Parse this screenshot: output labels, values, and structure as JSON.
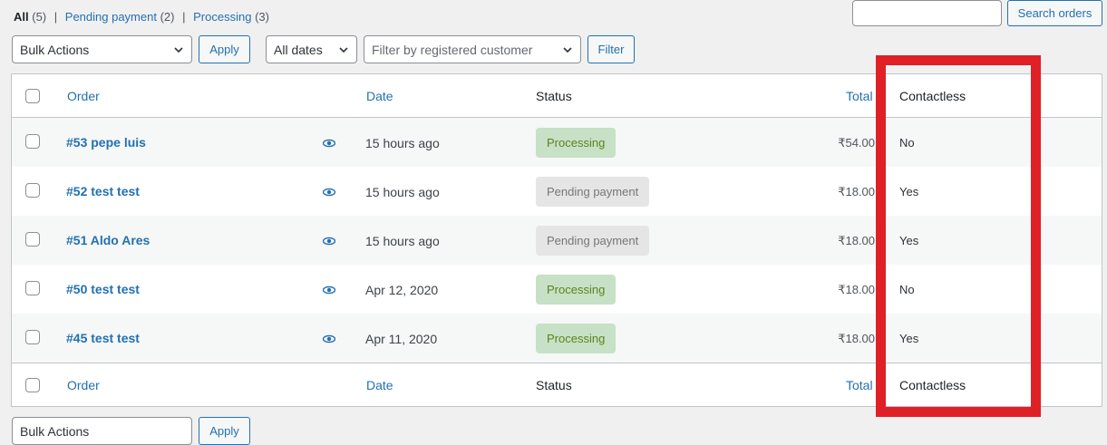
{
  "filters": {
    "all_label": "All",
    "all_count": "(5)",
    "pending_label": "Pending payment",
    "pending_count": "(2)",
    "processing_label": "Processing",
    "processing_count": "(3)",
    "separator": "|"
  },
  "search": {
    "value": "",
    "button_label": "Search orders"
  },
  "toolbar": {
    "bulk_actions": "Bulk Actions",
    "apply_label": "Apply",
    "dates": "All dates",
    "customer_placeholder": "Filter by registered customer",
    "filter_label": "Filter"
  },
  "columns": {
    "order": "Order",
    "date": "Date",
    "status": "Status",
    "total": "Total",
    "contactless": "Contactless"
  },
  "orders": [
    {
      "title": "#53 pepe luis",
      "date": "15 hours ago",
      "status": "Processing",
      "status_type": "processing",
      "total": "₹54.00",
      "contactless": "No"
    },
    {
      "title": "#52 test test",
      "date": "15 hours ago",
      "status": "Pending payment",
      "status_type": "pending",
      "total": "₹18.00",
      "contactless": "Yes"
    },
    {
      "title": "#51 Aldo Ares",
      "date": "15 hours ago",
      "status": "Pending payment",
      "status_type": "pending",
      "total": "₹18.00",
      "contactless": "Yes"
    },
    {
      "title": "#50 test test",
      "date": "Apr 12, 2020",
      "status": "Processing",
      "status_type": "processing",
      "total": "₹18.00",
      "contactless": "No"
    },
    {
      "title": "#45 test test",
      "date": "Apr 11, 2020",
      "status": "Processing",
      "status_type": "processing",
      "total": "₹18.00",
      "contactless": "Yes"
    }
  ],
  "icons": {
    "preview": "eye-icon",
    "dropdown": "chevron-down-icon"
  },
  "colors": {
    "link": "#2271b1",
    "highlight": "#e02027",
    "processing_bg": "#c6e1c6",
    "pending_bg": "#e5e5e5"
  }
}
